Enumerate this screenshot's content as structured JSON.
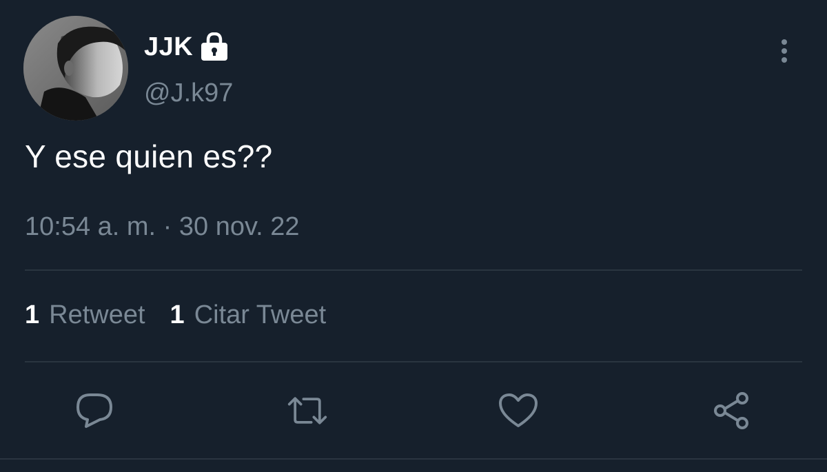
{
  "author": {
    "display_name": "JJK",
    "handle": "@J.k97",
    "protected_icon": "lock-icon",
    "avatar": "profile-photo"
  },
  "header": {
    "more_icon": "vertical-ellipsis-icon"
  },
  "tweet": {
    "text": "Y ese quien es??",
    "timestamp": "10:54 a. m. · 30 nov. 22"
  },
  "stats": [
    {
      "count": "1",
      "label": "Retweet"
    },
    {
      "count": "1",
      "label": "Citar Tweet"
    }
  ],
  "actions": [
    {
      "icon": "reply-icon"
    },
    {
      "icon": "retweet-icon"
    },
    {
      "icon": "like-icon"
    },
    {
      "icon": "share-icon"
    }
  ],
  "colors": {
    "background": "#16202c",
    "primary_text": "#ffffff",
    "secondary_text": "#7a8895",
    "divider": "#2a3540",
    "icon": "#7a8895"
  }
}
